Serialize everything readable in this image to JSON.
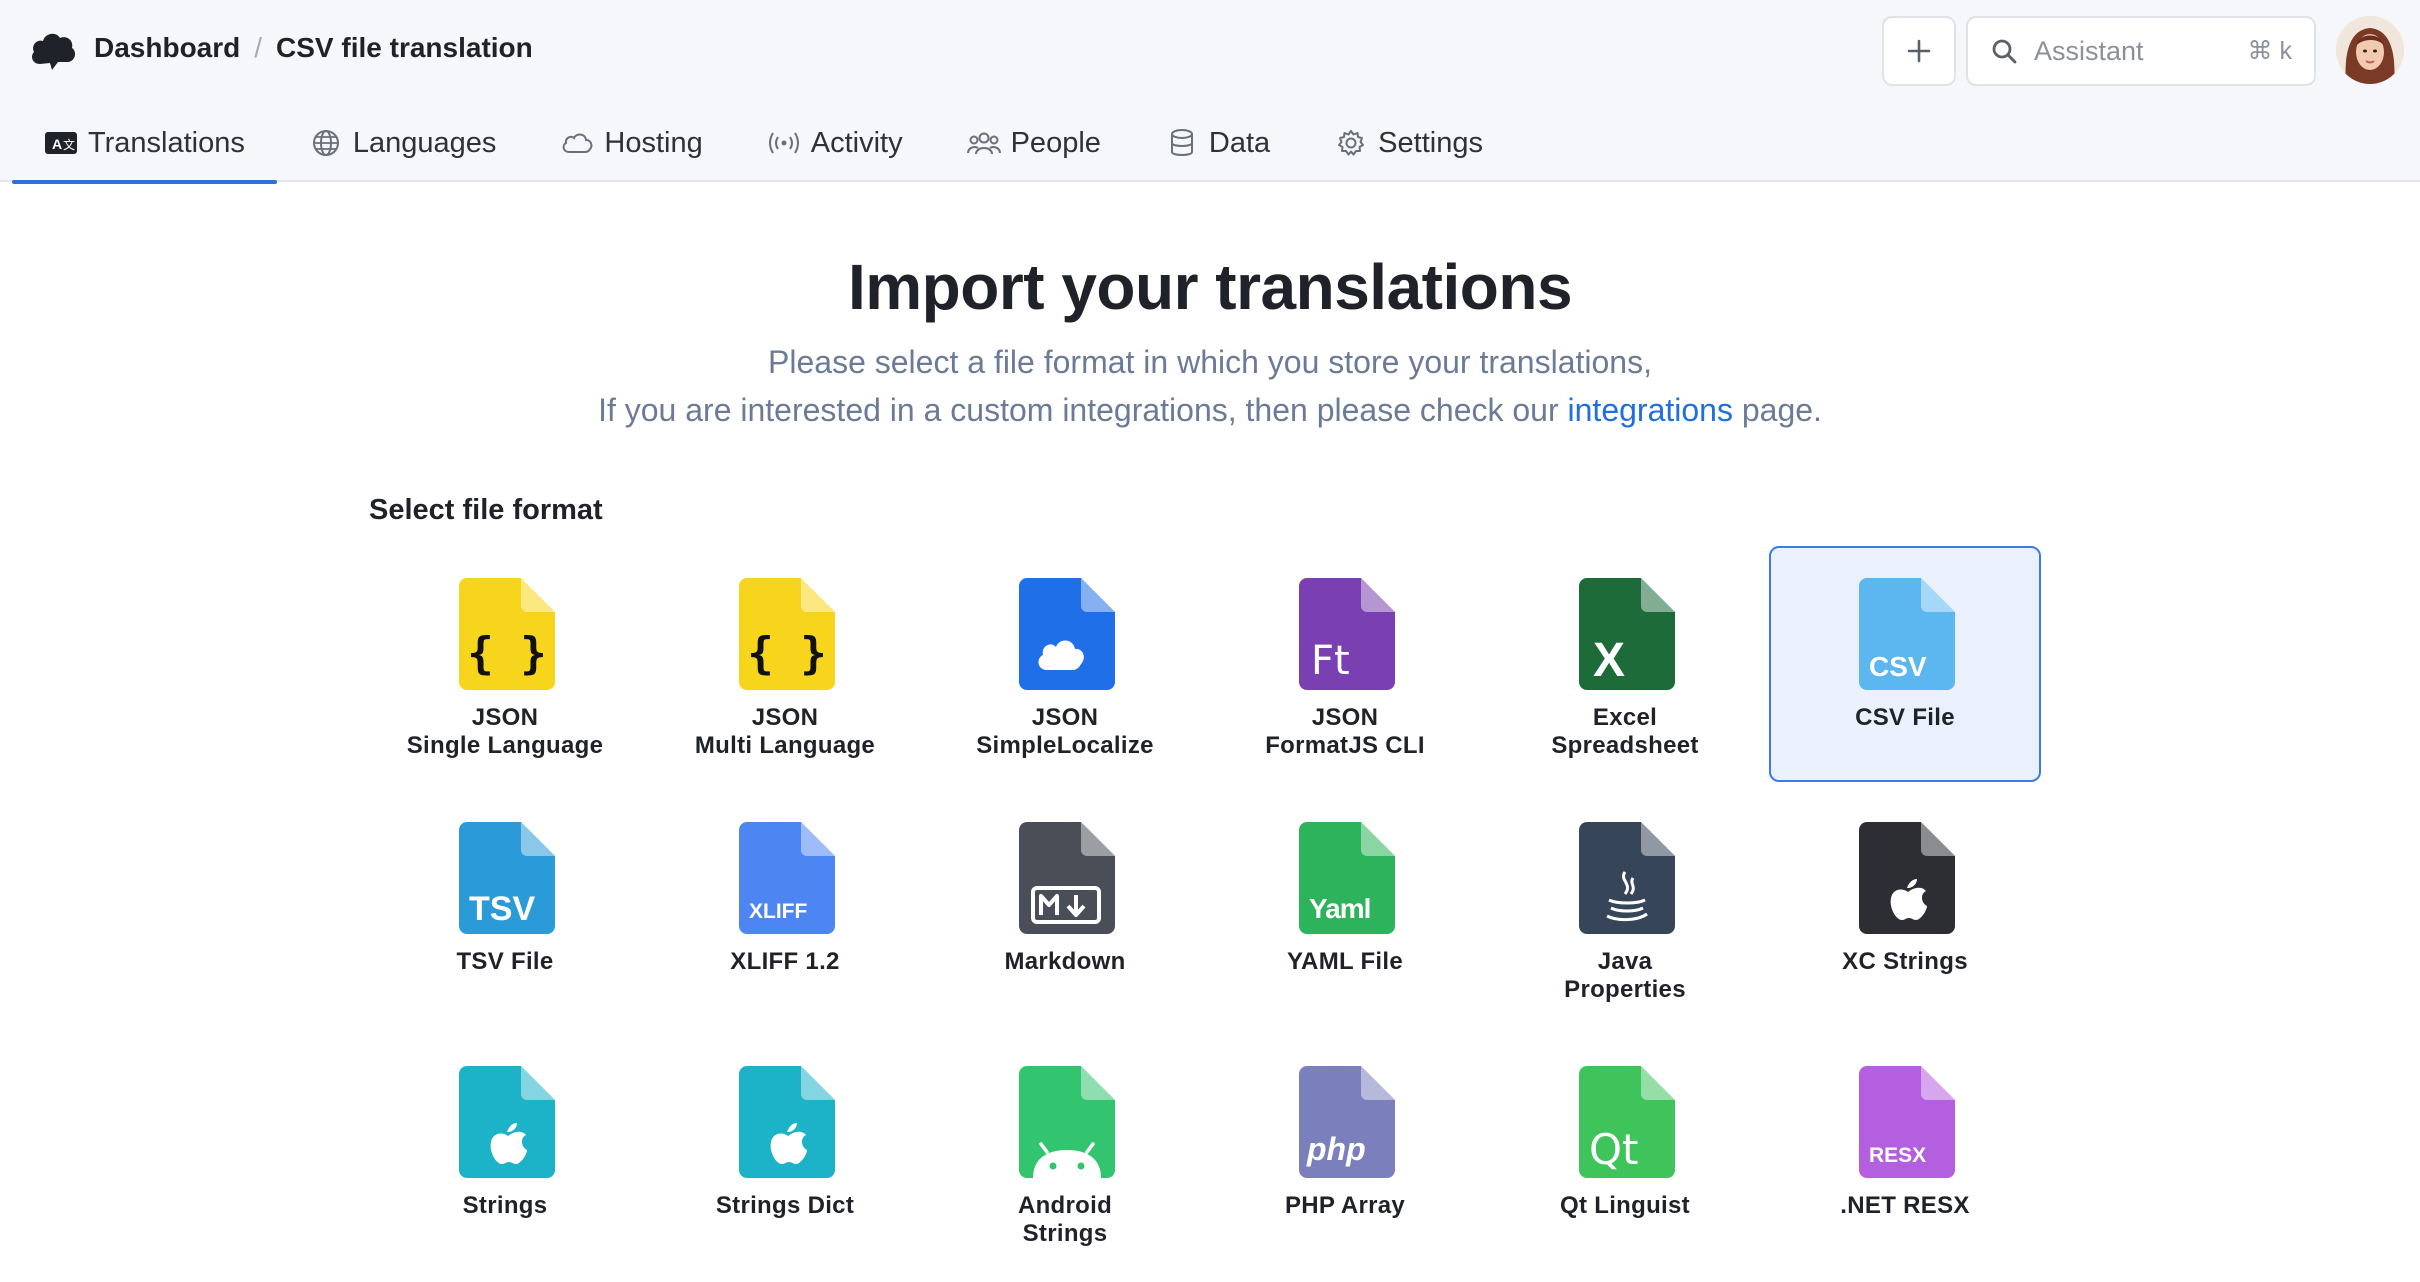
{
  "header": {
    "breadcrumb": [
      "Dashboard",
      "CSV file translation"
    ],
    "search_placeholder": "Assistant",
    "shortcut": "⌘ k"
  },
  "tabs": [
    {
      "label": "Translations",
      "icon": "translate-icon",
      "active": true
    },
    {
      "label": "Languages",
      "icon": "globe-icon"
    },
    {
      "label": "Hosting",
      "icon": "cloud-icon"
    },
    {
      "label": "Activity",
      "icon": "broadcast-icon"
    },
    {
      "label": "People",
      "icon": "people-icon"
    },
    {
      "label": "Data",
      "icon": "database-icon"
    },
    {
      "label": "Settings",
      "icon": "gear-icon"
    }
  ],
  "page": {
    "title": "Import your translations",
    "subtitle_line1": "Please select a file format in which you store your translations,",
    "subtitle_line2_prefix": "If you are interested in a custom integrations, then please check our",
    "subtitle_link": "integrations",
    "subtitle_line2_suffix": "page.",
    "section_label": "Select file format"
  },
  "formats": [
    {
      "name": "JSON",
      "sub": "Single Language",
      "glyph": "{ }",
      "color": "#f7d51d",
      "glyph_color": "#111111",
      "selected": false
    },
    {
      "name": "JSON",
      "sub": "Multi Language",
      "glyph": "{ }",
      "color": "#f7d51d",
      "glyph_color": "#111111",
      "selected": false
    },
    {
      "name": "JSON",
      "sub": "SimpleLocalize",
      "glyph": "cloud",
      "color": "#1f6fe8",
      "glyph_color": "#ffffff",
      "selected": false
    },
    {
      "name": "JSON",
      "sub": "FormatJS CLI",
      "glyph": "Ft",
      "color": "#7a3fb0",
      "glyph_color": "#ffffff",
      "selected": false
    },
    {
      "name": "Excel",
      "sub": "Spreadsheet",
      "glyph": "X",
      "color": "#1c6b39",
      "glyph_color": "#ffffff",
      "selected": false
    },
    {
      "name": "CSV File",
      "sub": "",
      "glyph": "CSV",
      "color": "#5cb6ef",
      "glyph_color": "#ffffff",
      "selected": true
    },
    {
      "name": "TSV File",
      "sub": "",
      "glyph": "TSV",
      "color": "#2b9ad8",
      "glyph_color": "#ffffff",
      "selected": false
    },
    {
      "name": "XLIFF 1.2",
      "sub": "",
      "glyph": "XLIFF",
      "color": "#4d86f3",
      "glyph_color": "#ffffff",
      "selected": false
    },
    {
      "name": "Markdown",
      "sub": "",
      "glyph": "M↓",
      "color": "#4a4f57",
      "glyph_color": "#ffffff",
      "selected": false
    },
    {
      "name": "YAML File",
      "sub": "",
      "glyph": "Yaml",
      "color": "#2db35c",
      "glyph_color": "#ffffff",
      "selected": false
    },
    {
      "name": "Java",
      "sub": "Properties",
      "glyph": "java",
      "color": "#364658",
      "glyph_color": "#ffffff",
      "selected": false
    },
    {
      "name": "XC Strings",
      "sub": "",
      "glyph": "apple",
      "color": "#2c2e33",
      "glyph_color": "#ffffff",
      "selected": false
    },
    {
      "name": "Strings",
      "sub": "",
      "glyph": "apple",
      "color": "#1cb3c8",
      "glyph_color": "#ffffff",
      "selected": false
    },
    {
      "name": "Strings Dict",
      "sub": "",
      "glyph": "apple",
      "color": "#1cb3c8",
      "glyph_color": "#ffffff",
      "selected": false
    },
    {
      "name": "Android",
      "sub": "Strings",
      "glyph": "android",
      "color": "#33c46f",
      "glyph_color": "#ffffff",
      "selected": false
    },
    {
      "name": "PHP Array",
      "sub": "",
      "glyph": "php",
      "color": "#7b80bd",
      "glyph_color": "#ffffff",
      "selected": false
    },
    {
      "name": "Qt Linguist",
      "sub": "",
      "glyph": "Qt",
      "color": "#3fc45c",
      "glyph_color": "#ffffff",
      "selected": false
    },
    {
      "name": ".NET RESX",
      "sub": "",
      "glyph": "RESX",
      "color": "#b45ee0",
      "glyph_color": "#ffffff",
      "selected": false
    }
  ]
}
